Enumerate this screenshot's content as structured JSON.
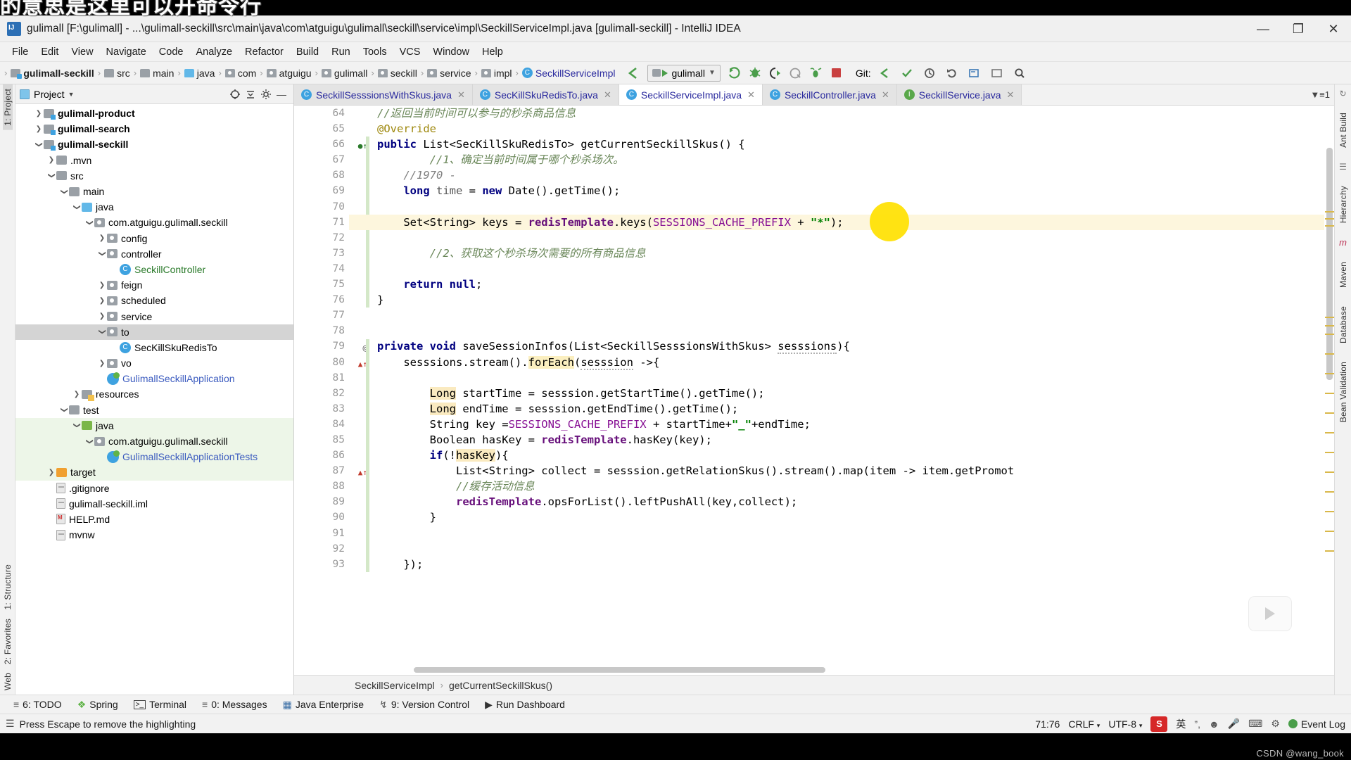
{
  "overlay_note": "的意思是这里可以开命令行",
  "window": {
    "title": "gulimall [F:\\gulimall] - ...\\gulimall-seckill\\src\\main\\java\\com\\atguigu\\gulimall\\seckill\\service\\impl\\SeckillServiceImpl.java [gulimall-seckill] - IntelliJ IDEA",
    "minimize": "—",
    "maximize": "❐",
    "close": "✕"
  },
  "menu": [
    {
      "label": "File"
    },
    {
      "label": "Edit"
    },
    {
      "label": "View"
    },
    {
      "label": "Navigate"
    },
    {
      "label": "Code"
    },
    {
      "label": "Analyze"
    },
    {
      "label": "Refactor"
    },
    {
      "label": "Build"
    },
    {
      "label": "Run"
    },
    {
      "label": "Tools"
    },
    {
      "label": "VCS"
    },
    {
      "label": "Window"
    },
    {
      "label": "Help"
    }
  ],
  "navbar": {
    "crumbs": [
      {
        "label": "gulimall-seckill",
        "icon": "module-icon",
        "bold": true
      },
      {
        "label": "src",
        "icon": "folder-icon"
      },
      {
        "label": "main",
        "icon": "folder-icon"
      },
      {
        "label": "java",
        "icon": "source-folder-icon"
      },
      {
        "label": "com",
        "icon": "package-icon"
      },
      {
        "label": "atguigu",
        "icon": "package-icon"
      },
      {
        "label": "gulimall",
        "icon": "package-icon"
      },
      {
        "label": "seckill",
        "icon": "package-icon"
      },
      {
        "label": "service",
        "icon": "package-icon"
      },
      {
        "label": "impl",
        "icon": "package-icon"
      },
      {
        "label": "SeckillServiceImpl",
        "icon": "class-icon",
        "cls": true
      }
    ],
    "run_config": "gulimall",
    "git_label": "Git:"
  },
  "project": {
    "panel_title": "Project",
    "tree": [
      {
        "indent": 1,
        "arrow": "right",
        "icon": "module-icon",
        "label": "gulimall-product",
        "style": "bold"
      },
      {
        "indent": 1,
        "arrow": "right",
        "icon": "module-icon",
        "label": "gulimall-search",
        "style": "bold"
      },
      {
        "indent": 1,
        "arrow": "down",
        "icon": "module-icon",
        "label": "gulimall-seckill",
        "style": "bold"
      },
      {
        "indent": 2,
        "arrow": "right",
        "icon": "folder-icon",
        "label": ".mvn",
        "style": ""
      },
      {
        "indent": 2,
        "arrow": "down",
        "icon": "folder-icon",
        "label": "src",
        "style": ""
      },
      {
        "indent": 3,
        "arrow": "down",
        "icon": "folder-icon",
        "label": "main",
        "style": ""
      },
      {
        "indent": 4,
        "arrow": "down",
        "icon": "source-folder-icon",
        "label": "java",
        "style": ""
      },
      {
        "indent": 5,
        "arrow": "down",
        "icon": "package-icon",
        "label": "com.atguigu.gulimall.seckill",
        "style": ""
      },
      {
        "indent": 6,
        "arrow": "right",
        "icon": "package-icon",
        "label": "config",
        "style": ""
      },
      {
        "indent": 6,
        "arrow": "down",
        "icon": "package-icon",
        "label": "controller",
        "style": ""
      },
      {
        "indent": 7,
        "arrow": "none",
        "icon": "class-icon",
        "label": "SeckillController",
        "style": "green"
      },
      {
        "indent": 6,
        "arrow": "right",
        "icon": "package-icon",
        "label": "feign",
        "style": ""
      },
      {
        "indent": 6,
        "arrow": "right",
        "icon": "package-icon",
        "label": "scheduled",
        "style": ""
      },
      {
        "indent": 6,
        "arrow": "right",
        "icon": "package-icon",
        "label": "service",
        "style": ""
      },
      {
        "indent": 6,
        "arrow": "down",
        "icon": "package-icon",
        "label": "to",
        "style": "selected"
      },
      {
        "indent": 7,
        "arrow": "none",
        "icon": "class-icon",
        "label": "SecKillSkuRedisTo",
        "style": ""
      },
      {
        "indent": 6,
        "arrow": "right",
        "icon": "package-icon",
        "label": "vo",
        "style": ""
      },
      {
        "indent": 6,
        "arrow": "none",
        "icon": "spring-icon",
        "label": "GulimallSeckillApplication",
        "style": "blue"
      },
      {
        "indent": 4,
        "arrow": "right",
        "icon": "resources-icon",
        "label": "resources",
        "style": ""
      },
      {
        "indent": 3,
        "arrow": "down",
        "icon": "folder-icon",
        "label": "test",
        "style": ""
      },
      {
        "indent": 4,
        "arrow": "down",
        "icon": "test-folder-icon",
        "label": "java",
        "style": "green-bg"
      },
      {
        "indent": 5,
        "arrow": "down",
        "icon": "package-icon",
        "label": "com.atguigu.gulimall.seckill",
        "style": "green-bg"
      },
      {
        "indent": 6,
        "arrow": "none",
        "icon": "spring-icon",
        "label": "GulimallSeckillApplicationTests",
        "style": "green-bg blue"
      },
      {
        "indent": 2,
        "arrow": "right",
        "icon": "target-folder-icon",
        "label": "target",
        "style": "green-bg"
      },
      {
        "indent": 2,
        "arrow": "none",
        "icon": "file-icon",
        "label": ".gitignore",
        "style": ""
      },
      {
        "indent": 2,
        "arrow": "none",
        "icon": "file-icon",
        "label": "gulimall-seckill.iml",
        "style": ""
      },
      {
        "indent": 2,
        "arrow": "none",
        "icon": "md-file-icon",
        "label": "HELP.md",
        "style": ""
      },
      {
        "indent": 2,
        "arrow": "none",
        "icon": "file-icon",
        "label": "mvnw",
        "style": ""
      }
    ]
  },
  "editor": {
    "tabs": [
      {
        "label": "SeckillSesssionsWithSkus.java",
        "active": false
      },
      {
        "label": "SecKillSkuRedisTo.java",
        "active": false
      },
      {
        "label": "SeckillServiceImpl.java",
        "active": true
      },
      {
        "label": "SeckillController.java",
        "active": false
      },
      {
        "label": "SeckillService.java",
        "active": false
      }
    ],
    "first_line_number": 64,
    "last_line_number": 93,
    "highlighted_line": 71,
    "lines": [
      {
        "n": 64,
        "marker": ""
      },
      {
        "n": 65,
        "marker": ""
      },
      {
        "n": 66,
        "marker": "override-impl"
      },
      {
        "n": 67,
        "marker": ""
      },
      {
        "n": 68,
        "marker": ""
      },
      {
        "n": 69,
        "marker": ""
      },
      {
        "n": 70,
        "marker": ""
      },
      {
        "n": 71,
        "marker": ""
      },
      {
        "n": 72,
        "marker": ""
      },
      {
        "n": 73,
        "marker": ""
      },
      {
        "n": 74,
        "marker": ""
      },
      {
        "n": 75,
        "marker": ""
      },
      {
        "n": 76,
        "marker": ""
      },
      {
        "n": 77,
        "marker": ""
      },
      {
        "n": 78,
        "marker": ""
      },
      {
        "n": 79,
        "marker": "@"
      },
      {
        "n": 80,
        "marker": "usage-arrow"
      },
      {
        "n": 81,
        "marker": ""
      },
      {
        "n": 82,
        "marker": ""
      },
      {
        "n": 83,
        "marker": ""
      },
      {
        "n": 84,
        "marker": ""
      },
      {
        "n": 85,
        "marker": ""
      },
      {
        "n": 86,
        "marker": ""
      },
      {
        "n": 87,
        "marker": "usage-arrow"
      },
      {
        "n": 88,
        "marker": ""
      },
      {
        "n": 89,
        "marker": ""
      },
      {
        "n": 90,
        "marker": ""
      },
      {
        "n": 91,
        "marker": ""
      },
      {
        "n": 92,
        "marker": ""
      },
      {
        "n": 93,
        "marker": ""
      }
    ],
    "source_text": [
      "//返回当前时间可以参与的秒杀商品信息",
      "@Override",
      "public List<SecKillSkuRedisTo> getCurrentSeckillSkus() {",
      "    //1、确定当前时间属于哪个秒杀场次。",
      "    //1970 -",
      "    long time = new Date().getTime();",
      "",
      "    Set<String> keys = redisTemplate.keys(SESSIONS_CACHE_PREFIX + \"*\");",
      "",
      "    //2、获取这个秒杀场次需要的所有商品信息",
      "",
      "    return null;",
      "}",
      "",
      "",
      "private void saveSessionInfos(List<SeckillSesssionsWithSkus> sesssions){",
      "    sesssions.stream().forEach(sesssion ->{",
      "",
      "        Long startTime = sesssion.getStartTime().getTime();",
      "        Long endTime = sesssion.getEndTime().getTime();",
      "        String key =SESSIONS_CACHE_PREFIX + startTime+\"_\"+endTime;",
      "        Boolean hasKey = redisTemplate.hasKey(key);",
      "        if(!hasKey){",
      "            List<String> collect = sesssion.getRelationSkus().stream().map(item -> item.getPromot",
      "            //缓存活动信息",
      "            redisTemplate.opsForList().leftPushAll(key,collect);",
      "        }",
      "",
      "",
      "    });"
    ],
    "breadcrumb": [
      "SeckillServiceImpl",
      "getCurrentSeckillSkus()"
    ]
  },
  "left_stripe": [
    {
      "label": "1: Project",
      "selected": true
    },
    {
      "label": "1: Structure",
      "selected": false
    },
    {
      "label": "2: Favorites",
      "selected": false
    },
    {
      "label": "Web",
      "selected": false
    }
  ],
  "right_stripe": [
    {
      "label": "Ant Build"
    },
    {
      "label": "Hierarchy"
    },
    {
      "label": "Maven"
    },
    {
      "label": "Database"
    },
    {
      "label": "Bean Validation"
    }
  ],
  "bottom_tools": [
    {
      "label": "6: TODO",
      "icon": "list-icon"
    },
    {
      "label": "Spring",
      "icon": "spring-leaf-icon"
    },
    {
      "label": "Terminal",
      "icon": "terminal-icon"
    },
    {
      "label": "0: Messages",
      "icon": "messages-icon"
    },
    {
      "label": "Java Enterprise",
      "icon": "java-ee-icon"
    },
    {
      "label": "9: Version Control",
      "icon": "branch-icon"
    },
    {
      "label": "Run Dashboard",
      "icon": "run-dashboard-icon"
    }
  ],
  "statusbar": {
    "message": "Press Escape to remove the highlighting",
    "caret": "71:76",
    "line_separator": "CRLF",
    "encoding": "UTF-8",
    "ime_badge": "S",
    "ime_lang": "英",
    "event_log": "Event Log"
  },
  "watermark": "CSDN @wang_book",
  "colors": {
    "accent_blue": "#3ea2e0",
    "keyword": "#000080",
    "string": "#008000",
    "field": "#660e7a",
    "static_field": "#871094",
    "comment": "#808080",
    "cn_comment": "#6a8759",
    "highlight_yellow": "#fbefc0",
    "line_highlight": "#fdf6dd",
    "selection_grey": "#d4d4d4",
    "test_green": "#edf6e8",
    "spot_yellow": "#ffe100"
  }
}
